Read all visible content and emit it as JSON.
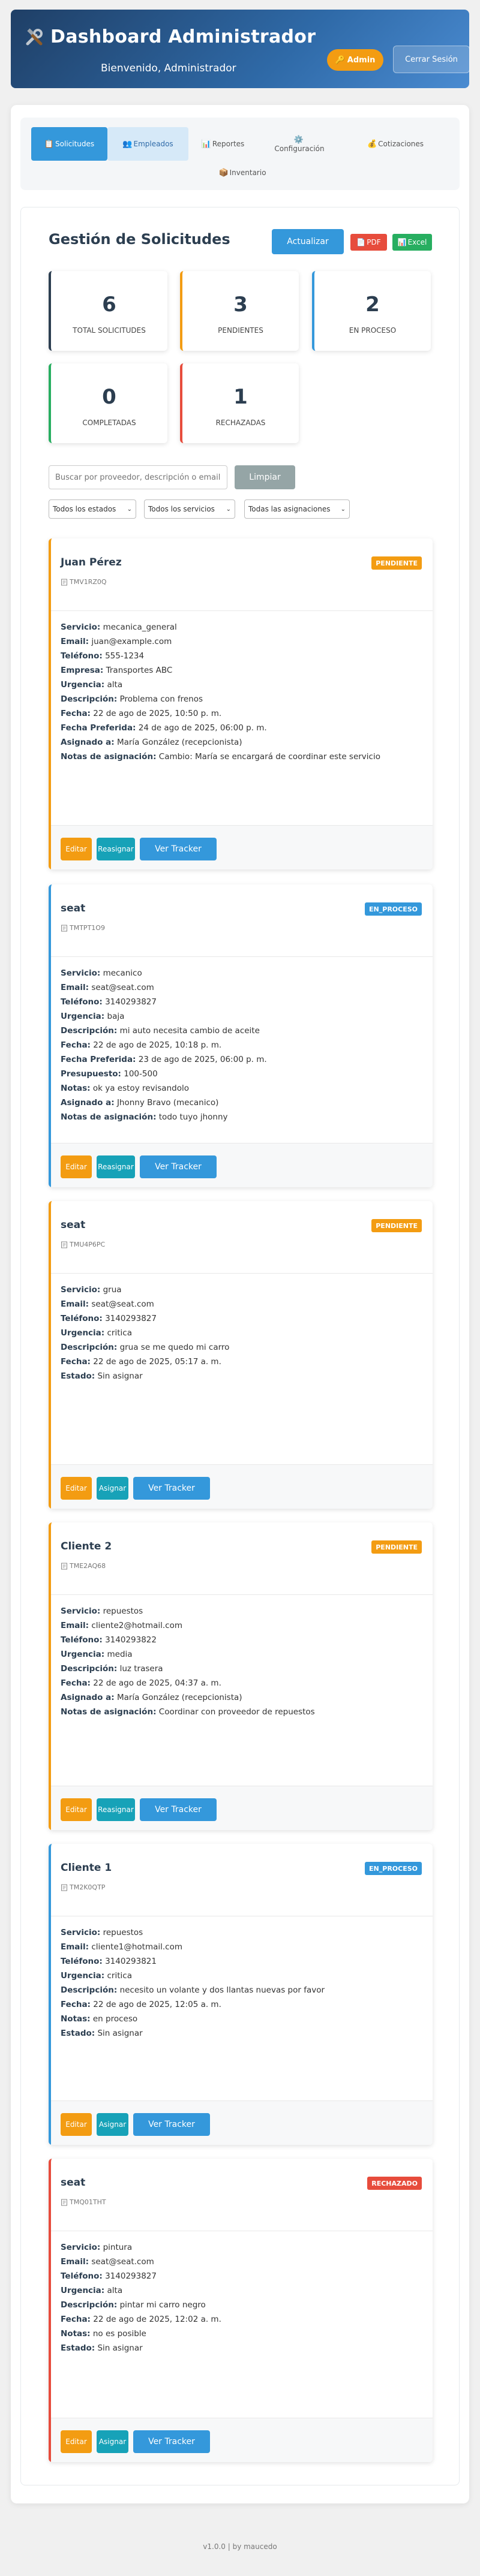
{
  "header": {
    "title": "Dashboard Administrador",
    "subtitle": "Bienvenido, Administrador",
    "role_badge": "Admin",
    "logout_label": "Cerrar Sesión"
  },
  "nav": {
    "tabs": [
      {
        "label": "Solicitudes",
        "icon": "clipboard-icon",
        "state": "active"
      },
      {
        "label": "Empleados",
        "icon": "people-icon",
        "state": "secondary"
      },
      {
        "label": "Reportes",
        "icon": "bar-chart-icon",
        "state": "normal"
      },
      {
        "label": "Configuración",
        "icon": "gear-icon",
        "state": "normal"
      },
      {
        "label": "Cotizaciones",
        "icon": "money-bag-icon",
        "state": "normal"
      },
      {
        "label": "Inventario",
        "icon": "box-icon",
        "state": "normal"
      }
    ]
  },
  "main": {
    "title": "Gestión de Solicitudes",
    "update_label": "Actualizar",
    "pdf_label": "PDF",
    "excel_label": "Excel"
  },
  "stats": [
    {
      "value": "6",
      "label": "TOTAL SOLICITUDES",
      "color": "#2c3e50"
    },
    {
      "value": "3",
      "label": "PENDIENTES",
      "color": "#f39c12"
    },
    {
      "value": "2",
      "label": "EN PROCESO",
      "color": "#3498db"
    },
    {
      "value": "0",
      "label": "COMPLETADAS",
      "color": "#27ae60"
    },
    {
      "value": "1",
      "label": "RECHAZADAS",
      "color": "#e74c3c"
    }
  ],
  "filters": {
    "search_placeholder": "Buscar por proveedor, descripción o email...",
    "clear_label": "Limpiar",
    "status_select": "Todos los estados",
    "service_select": "Todos los servicios",
    "assignment_select": "Todas las asignaciones"
  },
  "cards": [
    {
      "name": "Juan Pérez",
      "code": "TMV1RZ0Q",
      "status": "PENDIENTE",
      "color": "#f39c12",
      "fields": [
        {
          "label": "Servicio:",
          "value": "mecanica_general"
        },
        {
          "label": "Email:",
          "value": "juan@example.com"
        },
        {
          "label": "Teléfono:",
          "value": "555-1234"
        },
        {
          "label": "Empresa:",
          "value": "Transportes ABC"
        },
        {
          "label": "Urgencia:",
          "value": "alta"
        },
        {
          "label": "Descripción:",
          "value": "Problema con frenos"
        },
        {
          "label": "Fecha:",
          "value": "22 de ago de 2025, 10:50 p. m."
        },
        {
          "label": "Fecha Preferida:",
          "value": "24 de ago de 2025, 06:00 p. m."
        },
        {
          "label": "Asignado a:",
          "value": "María González (recepcionista)"
        },
        {
          "label": "Notas de asignación:",
          "value": "Cambio: María se encargará de coordinar este servicio"
        }
      ],
      "buttons": {
        "edit": "Editar",
        "mid": "Reasignar",
        "track": "Ver Tracker"
      }
    },
    {
      "name": "seat",
      "code": "TMTPT1O9",
      "status": "EN_PROCESO",
      "color": "#3498db",
      "fields": [
        {
          "label": "Servicio:",
          "value": "mecanico"
        },
        {
          "label": "Email:",
          "value": "seat@seat.com"
        },
        {
          "label": "Teléfono:",
          "value": "3140293827"
        },
        {
          "label": "Urgencia:",
          "value": "baja"
        },
        {
          "label": "Descripción:",
          "value": "mi auto necesita cambio de aceite"
        },
        {
          "label": "Fecha:",
          "value": "22 de ago de 2025, 10:18 p. m."
        },
        {
          "label": "Fecha Preferida:",
          "value": "23 de ago de 2025, 06:00 p. m."
        },
        {
          "label": "Presupuesto:",
          "value": "100-500"
        },
        {
          "label": "Notas:",
          "value": "ok ya estoy revisandolo"
        },
        {
          "label": "Asignado a:",
          "value": "Jhonny Bravo (mecanico)"
        },
        {
          "label": "Notas de asignación:",
          "value": "todo tuyo jhonny"
        }
      ],
      "buttons": {
        "edit": "Editar",
        "mid": "Reasignar",
        "track": "Ver Tracker"
      }
    },
    {
      "name": "seat",
      "code": "TMU4P6PC",
      "status": "PENDIENTE",
      "color": "#f39c12",
      "fields": [
        {
          "label": "Servicio:",
          "value": "grua"
        },
        {
          "label": "Email:",
          "value": "seat@seat.com"
        },
        {
          "label": "Teléfono:",
          "value": "3140293827"
        },
        {
          "label": "Urgencia:",
          "value": "critica"
        },
        {
          "label": "Descripción:",
          "value": "grua se me quedo mi carro"
        },
        {
          "label": "Fecha:",
          "value": "22 de ago de 2025, 05:17 a. m."
        },
        {
          "label": "Estado:",
          "value": "Sin asignar"
        }
      ],
      "buttons": {
        "edit": "Editar",
        "mid": "Asignar",
        "track": "Ver Tracker"
      }
    },
    {
      "name": "Cliente 2",
      "code": "TME2AQ68",
      "status": "PENDIENTE",
      "color": "#f39c12",
      "fields": [
        {
          "label": "Servicio:",
          "value": "repuestos"
        },
        {
          "label": "Email:",
          "value": "cliente2@hotmail.com"
        },
        {
          "label": "Teléfono:",
          "value": "3140293822"
        },
        {
          "label": "Urgencia:",
          "value": "media"
        },
        {
          "label": "Descripción:",
          "value": "luz trasera"
        },
        {
          "label": "Fecha:",
          "value": "22 de ago de 2025, 04:37 a. m."
        },
        {
          "label": "Asignado a:",
          "value": "María González (recepcionista)"
        },
        {
          "label": "Notas de asignación:",
          "value": "Coordinar con proveedor de repuestos"
        }
      ],
      "buttons": {
        "edit": "Editar",
        "mid": "Reasignar",
        "track": "Ver Tracker"
      }
    },
    {
      "name": "Cliente 1",
      "code": "TM2K0QTP",
      "status": "EN_PROCESO",
      "color": "#3498db",
      "fields": [
        {
          "label": "Servicio:",
          "value": "repuestos"
        },
        {
          "label": "Email:",
          "value": "cliente1@hotmail.com"
        },
        {
          "label": "Teléfono:",
          "value": "3140293821"
        },
        {
          "label": "Urgencia:",
          "value": "critica"
        },
        {
          "label": "Descripción:",
          "value": "necesito un volante y dos llantas nuevas por favor"
        },
        {
          "label": "Fecha:",
          "value": "22 de ago de 2025, 12:05 a. m."
        },
        {
          "label": "Notas:",
          "value": "en proceso"
        },
        {
          "label": "Estado:",
          "value": "Sin asignar"
        }
      ],
      "buttons": {
        "edit": "Editar",
        "mid": "Asignar",
        "track": "Ver Tracker"
      }
    },
    {
      "name": "seat",
      "code": "TMQ01THT",
      "status": "RECHAZADO",
      "color": "#e74c3c",
      "fields": [
        {
          "label": "Servicio:",
          "value": "pintura"
        },
        {
          "label": "Email:",
          "value": "seat@seat.com"
        },
        {
          "label": "Teléfono:",
          "value": "3140293827"
        },
        {
          "label": "Urgencia:",
          "value": "alta"
        },
        {
          "label": "Descripción:",
          "value": "pintar mi carro negro"
        },
        {
          "label": "Fecha:",
          "value": "22 de ago de 2025, 12:02 a. m."
        },
        {
          "label": "Notas:",
          "value": "no es posible"
        },
        {
          "label": "Estado:",
          "value": "Sin asignar"
        }
      ],
      "buttons": {
        "edit": "Editar",
        "mid": "Asignar",
        "track": "Ver Tracker"
      }
    }
  ],
  "footer": {
    "text": "v1.0.0 | by maucedo"
  }
}
